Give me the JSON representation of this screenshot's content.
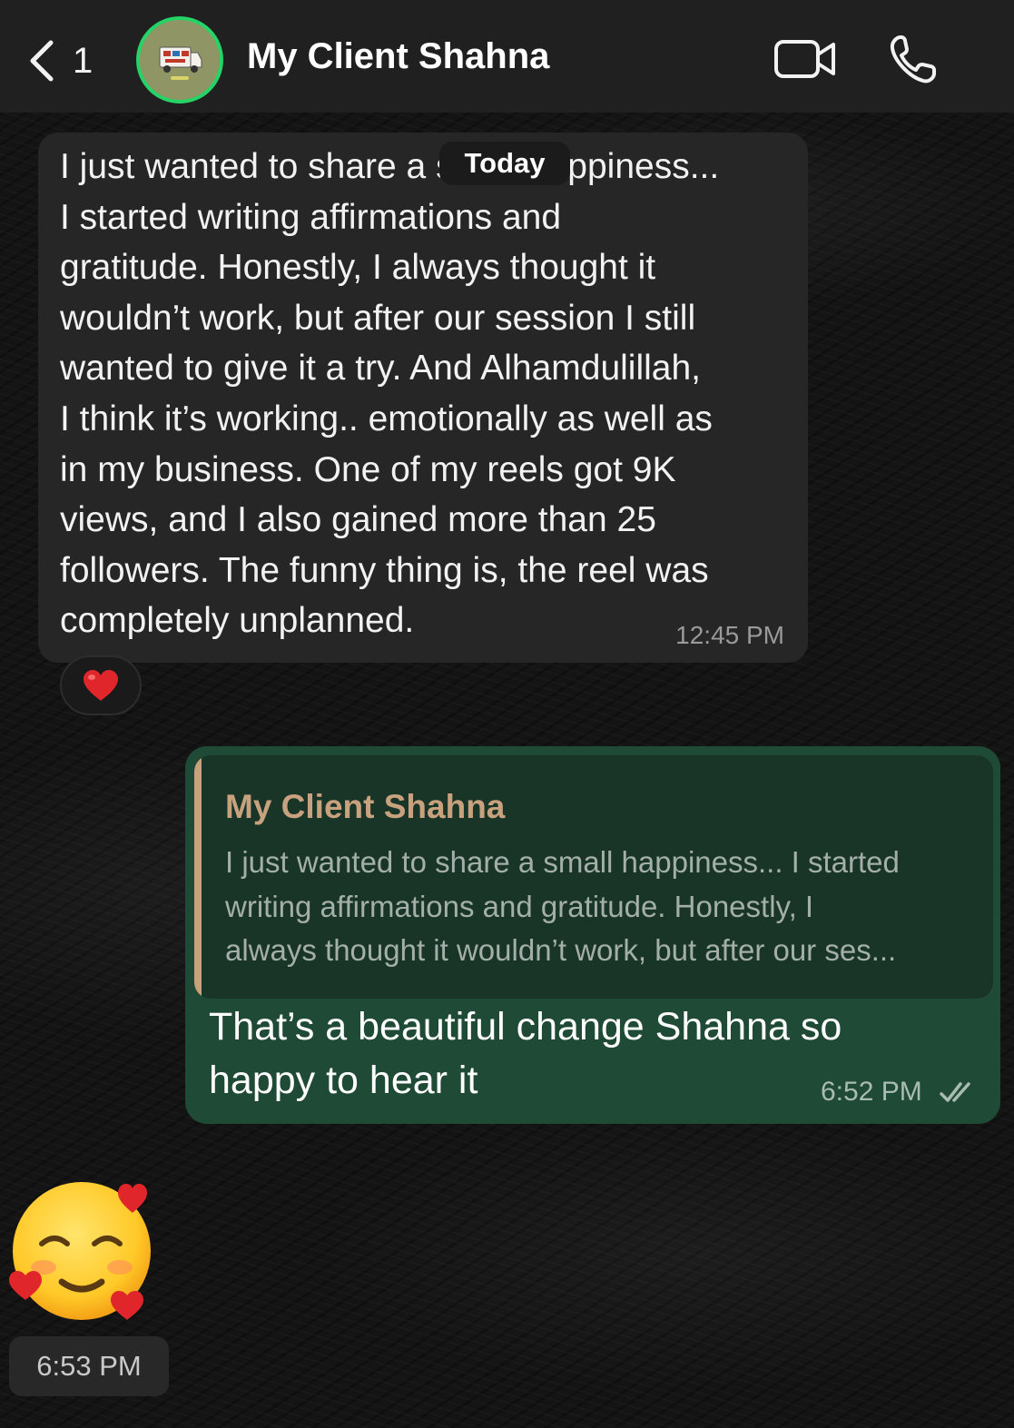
{
  "header": {
    "back_icon": "chevron-left-icon",
    "unread_count": "1",
    "contact_name": "My Client Shahna",
    "video_icon": "video-camera-icon",
    "call_icon": "phone-icon"
  },
  "date_chip": "Today",
  "messages": [
    {
      "direction": "incoming",
      "text": "I just wanted to share a small happiness...\nI started writing affirmations and\ngratitude. Honestly, I always thought it\nwouldn’t work, but after our session I still\nwanted to give it a try. And Alhamdulillah,\nI think it’s working.. emotionally as well as\nin my business. One of my reels got 9K\nviews, and I also gained more than 25\nfollowers. The funny thing is, the reel was\ncompletely unplanned.",
      "time": "12:45 PM",
      "reaction": "red-heart-icon"
    },
    {
      "direction": "outgoing",
      "quote": {
        "author": "My Client Shahna",
        "text": "I just wanted to share a small happiness... I started\nwriting affirmations and gratitude. Honestly, I\nalways thought it wouldn’t work, but after our ses..."
      },
      "text": "That’s a beautiful change Shahna so\nhappy to hear it",
      "time": "6:52 PM",
      "status_icon": "double-check-read-icon"
    },
    {
      "direction": "incoming",
      "sticker": "smiling-face-with-hearts-icon",
      "time": "6:53 PM"
    }
  ],
  "colors": {
    "header_bg": "#202020",
    "incoming_bubble": "#262626",
    "outgoing_bubble": "#1f4a35",
    "quote_accent": "#c8a27e",
    "avatar_ring": "#25d366"
  }
}
